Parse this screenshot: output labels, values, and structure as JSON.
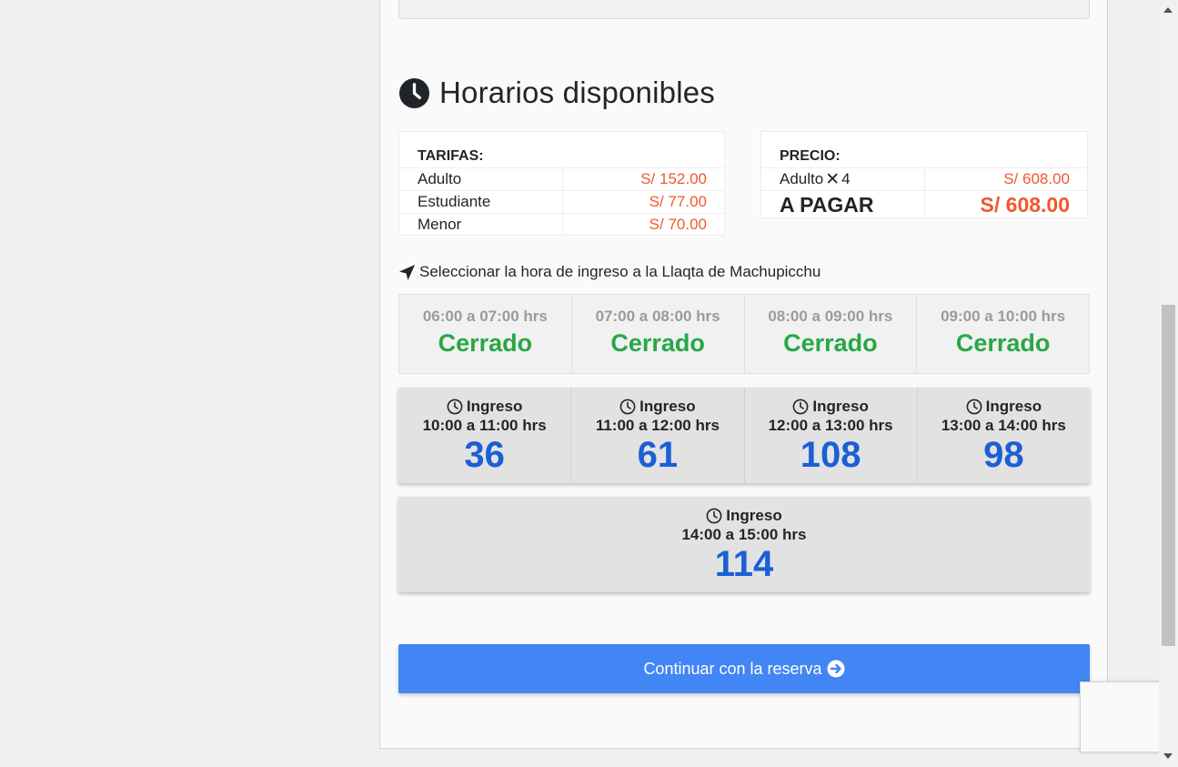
{
  "heading": {
    "title": "Horarios disponibles"
  },
  "tarifas": {
    "header": "TARIFAS:",
    "rows": [
      {
        "label": "Adulto",
        "price": "S/ 152.00"
      },
      {
        "label": "Estudiante",
        "price": "S/ 77.00"
      },
      {
        "label": "Menor",
        "price": "S/ 70.00"
      }
    ]
  },
  "precio": {
    "header": "PRECIO:",
    "line_label": "Adulto",
    "line_qty": "4",
    "line_price": "S/ 608.00",
    "total_label": "A PAGAR",
    "total_price": "S/ 608.00"
  },
  "select_label": "Seleccionar la hora de ingreso a la Llaqta de Machupicchu",
  "closed_slots": [
    {
      "time": "06:00 a 07:00 hrs",
      "state": "Cerrado"
    },
    {
      "time": "07:00 a 08:00 hrs",
      "state": "Cerrado"
    },
    {
      "time": "08:00 a 09:00 hrs",
      "state": "Cerrado"
    },
    {
      "time": "09:00 a 10:00 hrs",
      "state": "Cerrado"
    }
  ],
  "open_slots": [
    {
      "label": "Ingreso",
      "time": "10:00 a 11:00 hrs",
      "count": "36"
    },
    {
      "label": "Ingreso",
      "time": "11:00 a 12:00 hrs",
      "count": "61"
    },
    {
      "label": "Ingreso",
      "time": "12:00 a 13:00 hrs",
      "count": "108"
    },
    {
      "label": "Ingreso",
      "time": "13:00 a 14:00 hrs",
      "count": "98"
    },
    {
      "label": "Ingreso",
      "time": "14:00 a 15:00 hrs",
      "count": "114"
    }
  ],
  "continue_button": "Continuar con la reserva",
  "colors": {
    "price": "#f2572f",
    "closed": "#28a745",
    "count": "#1a5fd6",
    "button": "#4285f4"
  }
}
